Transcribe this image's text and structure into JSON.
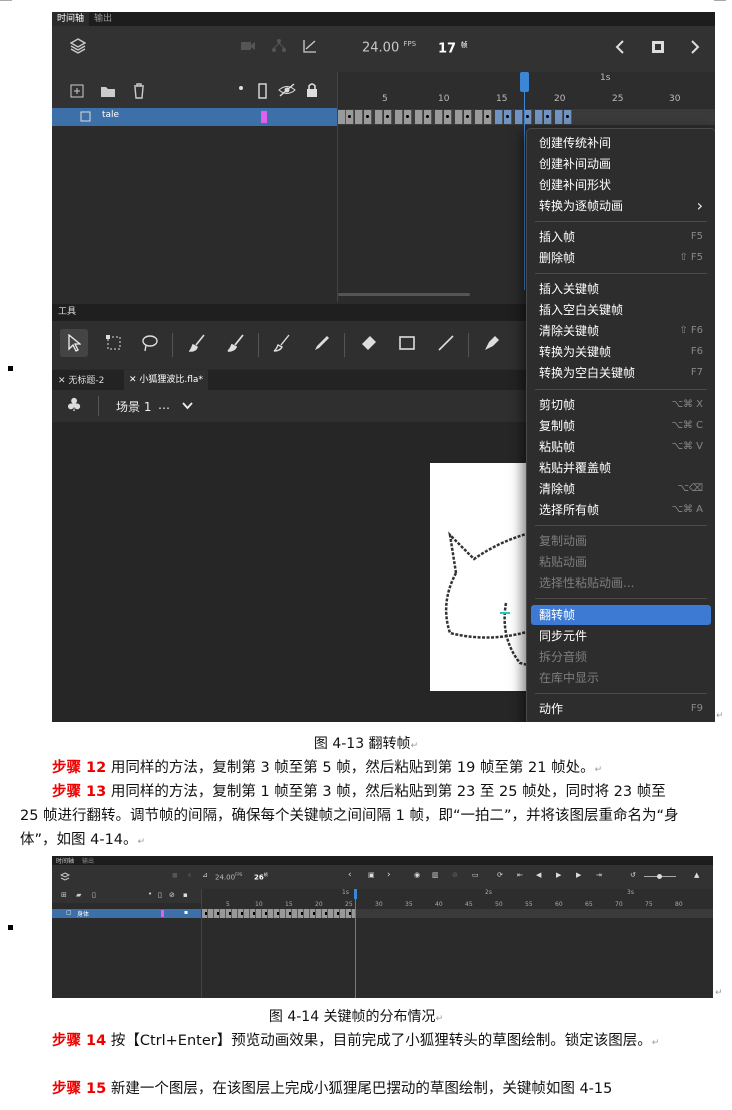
{
  "figure1": {
    "tabs": [
      "时间轴",
      "输出"
    ],
    "fps": "24.00",
    "fps_unit": "FPS",
    "current_frame": "17",
    "frame_unit": "帧",
    "ruler_second": "1s",
    "ruler_ticks": [
      "5",
      "10",
      "15",
      "20",
      "25",
      "30"
    ],
    "layer_name": "tale",
    "tools_title": "工具",
    "doc_tabs": [
      "无标题-2",
      "小狐狸波比.fla*"
    ],
    "scene": "场景 1",
    "scene_ellipsis": "…",
    "menu": [
      {
        "label": "创建传统补间",
        "shortcut": "",
        "disabled": false
      },
      {
        "label": "创建补间动画",
        "shortcut": "",
        "disabled": false
      },
      {
        "label": "创建补间形状",
        "shortcut": "",
        "disabled": false
      },
      {
        "label": "转换为逐帧动画",
        "shortcut": "›",
        "disabled": false
      },
      {
        "label": "插入帧",
        "shortcut": "F5",
        "disabled": false
      },
      {
        "label": "删除帧",
        "shortcut": "⇧ F5",
        "disabled": false
      },
      {
        "label": "插入关键帧",
        "shortcut": "",
        "disabled": false
      },
      {
        "label": "插入空白关键帧",
        "shortcut": "",
        "disabled": false
      },
      {
        "label": "清除关键帧",
        "shortcut": "⇧ F6",
        "disabled": false
      },
      {
        "label": "转换为关键帧",
        "shortcut": "F6",
        "disabled": false
      },
      {
        "label": "转换为空白关键帧",
        "shortcut": "F7",
        "disabled": false
      },
      {
        "label": "剪切帧",
        "shortcut": "⌥⌘ X",
        "disabled": false
      },
      {
        "label": "复制帧",
        "shortcut": "⌥⌘ C",
        "disabled": false
      },
      {
        "label": "粘贴帧",
        "shortcut": "⌥⌘ V",
        "disabled": false
      },
      {
        "label": "粘贴并覆盖帧",
        "shortcut": "",
        "disabled": false
      },
      {
        "label": "清除帧",
        "shortcut": "⌥⌫",
        "disabled": false
      },
      {
        "label": "选择所有帧",
        "shortcut": "⌥⌘ A",
        "disabled": false
      },
      {
        "label": "复制动画",
        "shortcut": "",
        "disabled": true
      },
      {
        "label": "粘贴动画",
        "shortcut": "",
        "disabled": true
      },
      {
        "label": "选择性粘贴动画...",
        "shortcut": "",
        "disabled": true
      },
      {
        "label": "翻转帧",
        "shortcut": "",
        "disabled": false,
        "highlighted": true
      },
      {
        "label": "同步元件",
        "shortcut": "",
        "disabled": false
      },
      {
        "label": "拆分音频",
        "shortcut": "",
        "disabled": true
      },
      {
        "label": "在库中显示",
        "shortcut": "",
        "disabled": true
      },
      {
        "label": "动作",
        "shortcut": "F9",
        "disabled": false
      }
    ]
  },
  "caption1": "图 4-13 翻转帧",
  "para12": {
    "step": "步骤 12",
    "text": " 用同样的方法，复制第 3 帧至第 5 帧，然后粘贴到第 19 帧至第 21 帧处。"
  },
  "para13": {
    "step": "步骤 13",
    "text": " 用同样的方法，复制第 1 帧至第 3 帧，然后粘贴到第 23 至 25 帧处，同时将 23 帧至 25 帧进行翻转。调节帧的间隔，确保每个关键帧之间间隔 1 帧，即“一拍二”，并将该图层重命名为“身体”，如图 4-14。"
  },
  "figure2": {
    "tabs": [
      "时间轴",
      "输出"
    ],
    "fps": "24.00",
    "fps_unit": "FPS",
    "current_frame": "26",
    "frame_unit": "帧",
    "ruler_seconds": [
      "1s",
      "2s",
      "3s"
    ],
    "ruler_ticks": [
      "5",
      "10",
      "15",
      "20",
      "25",
      "30",
      "35",
      "40",
      "45",
      "50",
      "55",
      "60",
      "65",
      "70",
      "75",
      "80"
    ],
    "layer_name": "身体"
  },
  "caption2": "图 4-14 关键帧的分布情况",
  "para14": {
    "step": "步骤 14",
    "text": " 按【Ctrl+Enter】预览动画效果，目前完成了小狐狸转头的草图绘制。锁定该图层。"
  },
  "para15": {
    "step": "步骤 15",
    "text": " 新建一个图层，在该图层上完成小狐狸尾巴摆动的草图绘制，关键帧如图 4-15"
  },
  "return_mark": "↵"
}
